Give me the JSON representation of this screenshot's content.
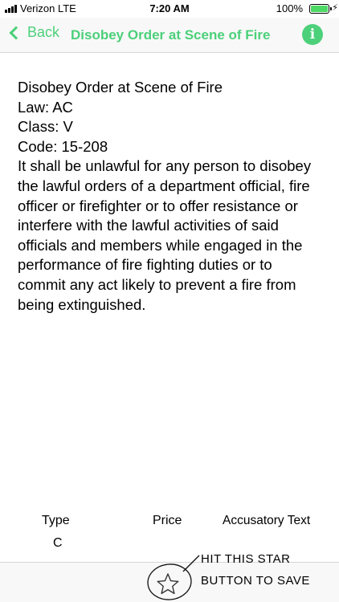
{
  "status_bar": {
    "carrier": "Verizon  LTE",
    "time": "7:20 AM",
    "battery": "100%",
    "battery_color": "#4cd964"
  },
  "nav": {
    "back_label": "Back",
    "title": "Disobey Order at Scene of Fire",
    "info_icon": "i",
    "accent_color": "#4cd07a"
  },
  "ordinance": {
    "name": "Disobey Order at Scene of Fire",
    "law": "Law: AC",
    "class": "Class: V",
    "code": "Code: 15-208",
    "description": "It shall be unlawful for any person to disobey the lawful orders of a department official, fire officer or firefighter or to offer resistance or interfere with the lawful activities of said officials and members while engaged in the performance of fire fighting duties or to commit any act likely to prevent a fire from being extinguished."
  },
  "table": {
    "headers": [
      "Type",
      "Price",
      "Accusatory Text"
    ],
    "type_value": "C"
  },
  "toolbar": {
    "star_icon": "star-outline-icon"
  },
  "annotation": {
    "line1": "HIT THIS STAR",
    "line2": "BUTTON TO SAVE"
  }
}
